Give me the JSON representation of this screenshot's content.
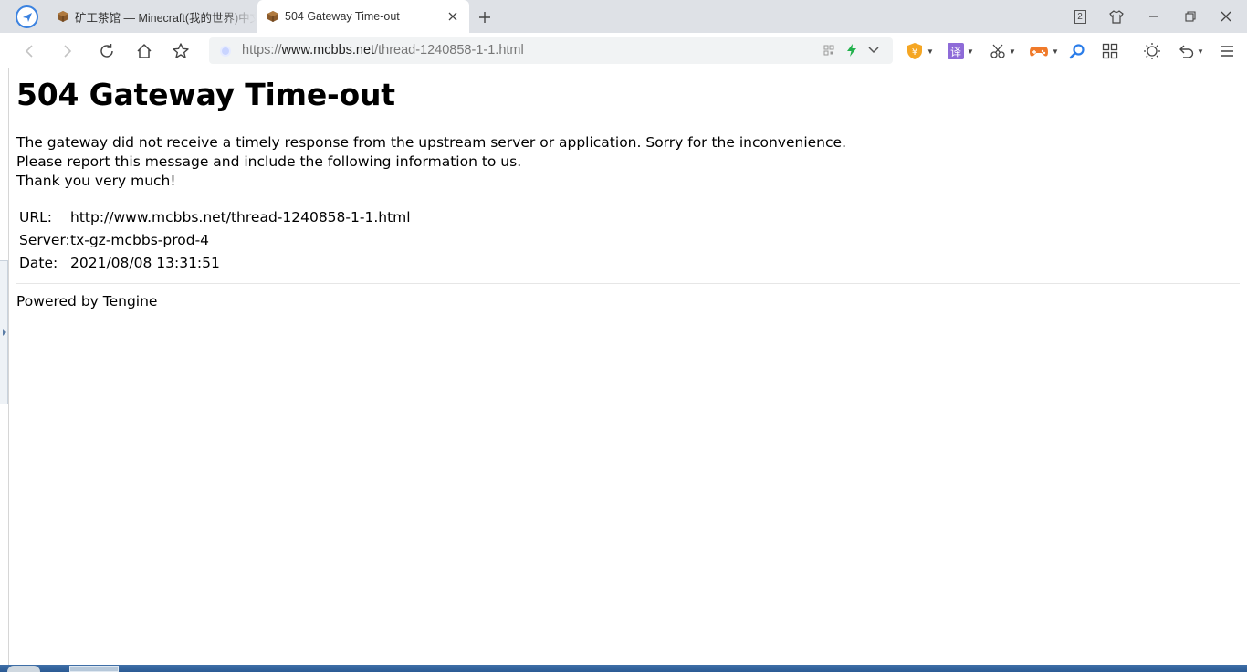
{
  "tabs": [
    {
      "title": "矿工茶馆 — Minecraft(我的世界)中文论坛",
      "active": false,
      "favicon": "minecraft-block-icon"
    },
    {
      "title": "504 Gateway Time-out",
      "active": true,
      "favicon": "minecraft-block-icon"
    }
  ],
  "window": {
    "badge_count": "2"
  },
  "omnibox": {
    "scheme": "https://",
    "host": "www.mcbbs.net",
    "path": "/thread-1240858-1-1.html"
  },
  "toolbar": {
    "translate_label": "译"
  },
  "page": {
    "heading": "504 Gateway Time-out",
    "line1": "The gateway did not receive a timely response from the upstream server or application. Sorry for the inconvenience.",
    "line2": "Please report this message and include the following information to us.",
    "line3": "Thank you very much!",
    "info": [
      {
        "key": "URL:",
        "value": "http://www.mcbbs.net/thread-1240858-1-1.html"
      },
      {
        "key": "Server:",
        "value": "tx-gz-mcbbs-prod-4"
      },
      {
        "key": "Date:",
        "value": "2021/08/08 13:31:51"
      }
    ],
    "footer": "Powered by Tengine"
  },
  "colors": {
    "tabstrip": "#dee1e6",
    "accent": "#3b82e0",
    "omnibox_bg": "#f1f3f4"
  }
}
